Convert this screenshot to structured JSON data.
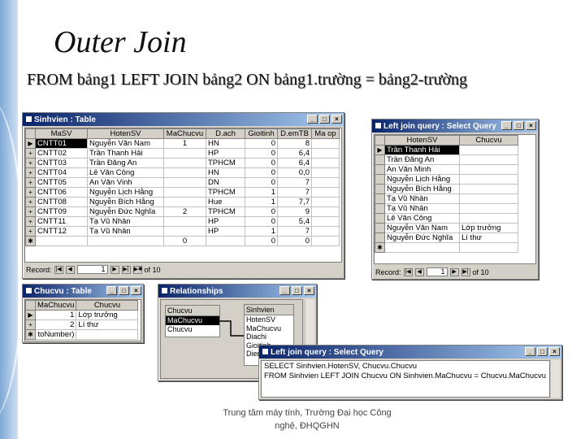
{
  "slide": {
    "title": "Outer Join",
    "subtitle": "FROM bảng1 LEFT JOIN bảng2 ON bảng1.trường = bảng2-trường",
    "footer_line1": "Trung tâm máy tính, Trường Đại học Công",
    "footer_line2": "nghệ, ĐHQGHN"
  },
  "sinhvien": {
    "title": "Sinhvien : Table",
    "columns": [
      "MaSV",
      "HotenSV",
      "MaChucvu",
      "Diachi",
      "Gioitinh",
      "DiemTB",
      "Malop"
    ],
    "columns_display": [
      "MaSV",
      "HotenSV",
      "MaChucvu",
      "D.ach",
      "Gioitinh",
      "D.emTB",
      "Ma op"
    ],
    "rows": [
      {
        "mark": "▶",
        "masv": "CNTT01",
        "hoten": "Nguyễn Văn Nam",
        "machucvu": "1",
        "diachi": "HN",
        "gioitinh": "0",
        "diemtb": "8",
        "malop": ""
      },
      {
        "mark": "+",
        "masv": "CNTT02",
        "hoten": "Trần Thanh Hải",
        "machucvu": "",
        "diachi": "HP",
        "gioitinh": "0",
        "diemtb": "6,4",
        "malop": ""
      },
      {
        "mark": "+",
        "masv": "CNTT03",
        "hoten": "Trần Đăng An",
        "machucvu": "",
        "diachi": "TPHCM",
        "gioitinh": "0",
        "diemtb": "6,4",
        "malop": ""
      },
      {
        "mark": "+",
        "masv": "CNTT04",
        "hoten": "Lê Văn Công",
        "machucvu": "",
        "diachi": "HN",
        "gioitinh": "0",
        "diemtb": "0,0",
        "malop": ""
      },
      {
        "mark": "+",
        "masv": "CNTT05",
        "hoten": "An Văn Vinh",
        "machucvu": "",
        "diachi": "DN",
        "gioitinh": "0",
        "diemtb": "7",
        "malop": ""
      },
      {
        "mark": "+",
        "masv": "CNTT06",
        "hoten": "Nguyễn Lịch Hằng",
        "machucvu": "",
        "diachi": "TPHCM",
        "gioitinh": "1",
        "diemtb": "7",
        "malop": ""
      },
      {
        "mark": "+",
        "masv": "CNTT08",
        "hoten": "Nguyễn Bích Hằng",
        "machucvu": "",
        "diachi": "Hue",
        "gioitinh": "1",
        "diemtb": "7,7",
        "malop": ""
      },
      {
        "mark": "+",
        "masv": "CNTT09",
        "hoten": "Nguyễn Đức Nghĩa",
        "machucvu": "2",
        "diachi": "TPHCM",
        "gioitinh": "0",
        "diemtb": "9",
        "malop": ""
      },
      {
        "mark": "+",
        "masv": "CNTT11",
        "hoten": "Tạ Vũ Nhân",
        "machucvu": "",
        "diachi": "HP",
        "gioitinh": "0",
        "diemtb": "5,4",
        "malop": ""
      },
      {
        "mark": "+",
        "masv": "CNTT12",
        "hoten": "Tạ Vũ Nhân",
        "machucvu": "",
        "diachi": "HP",
        "gioitinh": "1",
        "diemtb": "7",
        "malop": ""
      },
      {
        "mark": "✱",
        "masv": "",
        "hoten": "",
        "machucvu": "0",
        "diachi": "",
        "gioitinh": "0",
        "diemtb": "0",
        "malop": ""
      }
    ],
    "record_label": "Record:",
    "record_current": "1",
    "record_of": "of 10"
  },
  "left_join_result": {
    "title": "Left join query : Select Query",
    "columns": [
      "HotenSV",
      "Chucvu"
    ],
    "rows": [
      {
        "mark": "▶",
        "hoten": "Trần Thanh Hải",
        "chucvu": ""
      },
      {
        "mark": "",
        "hoten": "Trần Đăng An",
        "chucvu": ""
      },
      {
        "mark": "",
        "hoten": "An Văn Minh",
        "chucvu": ""
      },
      {
        "mark": "",
        "hoten": "Nguyễn Lịch Hằng",
        "chucvu": ""
      },
      {
        "mark": "",
        "hoten": "Nguyễn Bích Hằng",
        "chucvu": ""
      },
      {
        "mark": "",
        "hoten": "Tạ Vũ Nhân",
        "chucvu": ""
      },
      {
        "mark": "",
        "hoten": "Tạ Vũ Nhân",
        "chucvu": ""
      },
      {
        "mark": "",
        "hoten": "Lê Văn Công",
        "chucvu": ""
      },
      {
        "mark": "",
        "hoten": "Nguyễn Văn Nam",
        "chucvu": "Lớp trưởng"
      },
      {
        "mark": "",
        "hoten": "Nguyễn Đức Nghĩa",
        "chucvu": "Lí thư"
      },
      {
        "mark": "✱",
        "hoten": "",
        "chucvu": ""
      }
    ],
    "record_label": "Record:",
    "record_current": "1",
    "record_of": "of 10"
  },
  "chucvu": {
    "title": "Chucvu : Table",
    "columns": [
      "MaChucvu",
      "Chucvu"
    ],
    "rows": [
      {
        "mark": "▶",
        "ma": "1",
        "chucvu": "Lớp trưởng"
      },
      {
        "mark": "+",
        "ma": "2",
        "chucvu": "Lí thư"
      },
      {
        "mark": "✱",
        "ma": "toNumber)",
        "chucvu": ""
      }
    ]
  },
  "relationships": {
    "title": "Relationships",
    "table1_name": "Chucvu",
    "table1_fields": [
      "MaChucvu",
      "Chucvu"
    ],
    "table2_name": "Sinhvien",
    "table2_fields": [
      "HotenSV",
      "MaChucvu",
      "Diachi",
      "Gioitinh",
      "Diem"
    ]
  },
  "sql_window": {
    "title": "Left join query : Select Query",
    "line1": "SELECT Sinhvien.HotenSV, Chucvu.Chucvu",
    "line2": "FROM Sinhvien LEFT JOIN Chucvu ON Sinhvien.MaChucvu = Chucvu.MaChucvu"
  },
  "window_buttons": {
    "min": "_",
    "max": "□",
    "close": "×"
  },
  "nav": {
    "first": "|◀",
    "prev": "◀",
    "next": "▶",
    "last": "▶|",
    "new": "▶✱"
  }
}
